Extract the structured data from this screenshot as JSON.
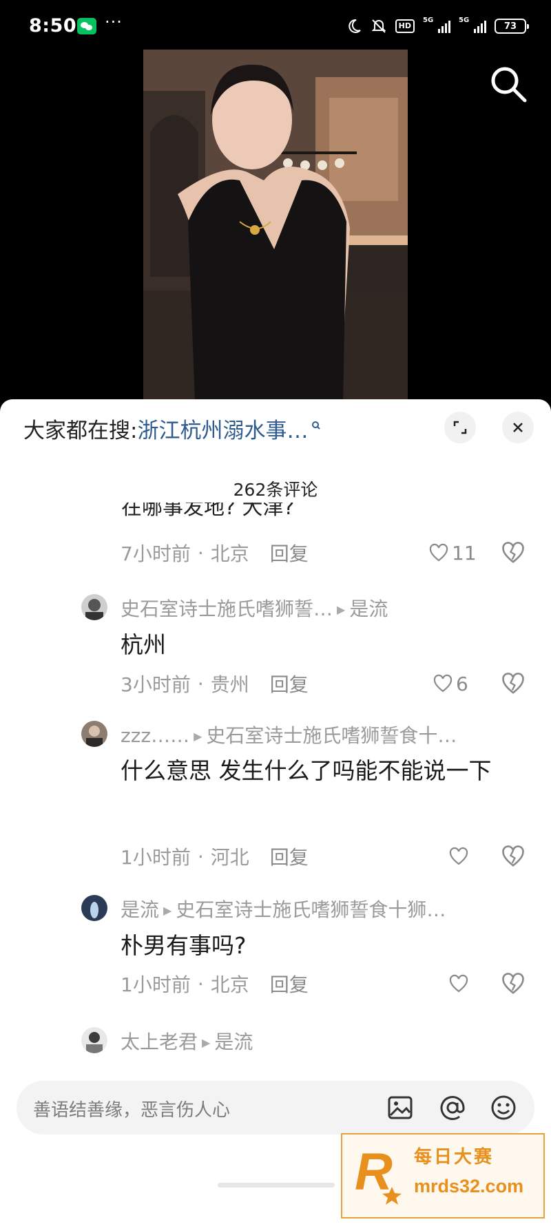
{
  "status_bar": {
    "time": "8:50",
    "more": "···",
    "network_1": "5G",
    "network_2": "5G",
    "battery": "73",
    "hd_badge": "HD",
    "icons": [
      "wechat-icon",
      "moon-icon",
      "mute-icon",
      "signal-icon",
      "battery-icon"
    ]
  },
  "video": {
    "icons": [
      "search-icon"
    ]
  },
  "sheet": {
    "trend_prefix": "大家都在搜:",
    "trend_query": "浙江杭州溺水事…",
    "comment_count": "262条评论",
    "cut_text": "在哪事发地? 大津?",
    "icons": [
      "expand-icon",
      "close-icon"
    ]
  },
  "comments": [
    {
      "time": "7小时前",
      "location": "北京",
      "reply": "回复",
      "likes": "11"
    },
    {
      "user": "史石室诗士施氏嗜狮誓…",
      "reply_to": "是流",
      "text": "杭州",
      "time": "3小时前",
      "location": "贵州",
      "reply": "回复",
      "likes": "6"
    },
    {
      "user": "zzz……",
      "reply_to": "史石室诗士施氏嗜狮誓食十…",
      "text": "什么意思 发生什么了吗能不能说一下",
      "time": "1小时前",
      "location": "河北",
      "reply": "回复",
      "likes": ""
    },
    {
      "user": "是流",
      "reply_to": "史石室诗士施氏嗜狮誓食十狮…",
      "text": "朴男有事吗?",
      "time": "1小时前",
      "location": "北京",
      "reply": "回复",
      "likes": ""
    },
    {
      "user": "太上老君",
      "reply_to": "是流"
    }
  ],
  "input": {
    "placeholder": "善语结善缘，恶言伤人心",
    "icons": [
      "image-icon",
      "at-icon",
      "emoji-icon"
    ]
  },
  "watermark": {
    "title": "每日大赛",
    "domain": "mrds32.com",
    "logo_letter": "R"
  },
  "colors": {
    "accent_link": "#2f5a8e",
    "watermark": "#e8901d",
    "wechat": "#07c160"
  }
}
